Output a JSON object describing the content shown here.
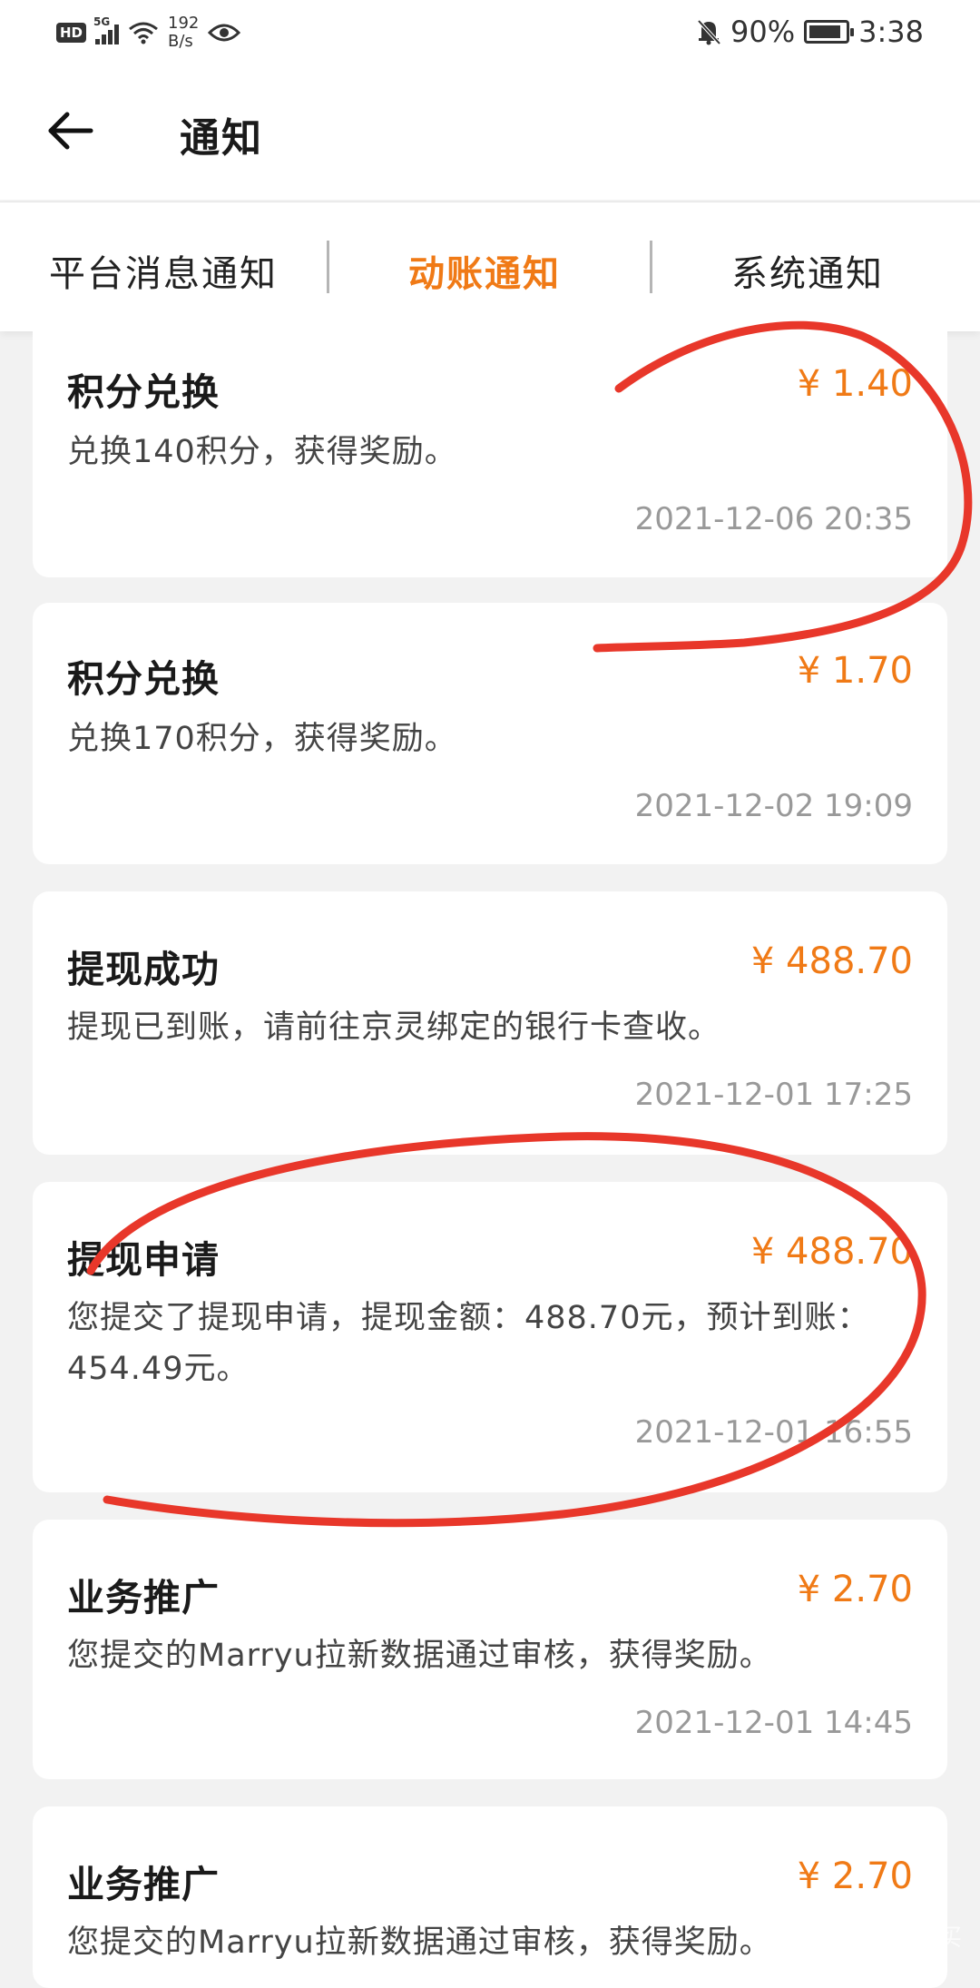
{
  "status_bar": {
    "hd": "HD",
    "network": "5G",
    "speed_value": "192",
    "speed_unit": "B/s",
    "battery": "90%",
    "battery_level": 0.9,
    "time": "3:38"
  },
  "header": {
    "title": "通知"
  },
  "tabs": [
    {
      "label": "平台消息通知",
      "active": false
    },
    {
      "label": "动账通知",
      "active": true
    },
    {
      "label": "系统通知",
      "active": false
    }
  ],
  "colors": {
    "accent": "#f07a16",
    "annotation": "#e8372a"
  },
  "cards": [
    {
      "title": "积分兑换",
      "amount": "¥ 1.40",
      "desc": "兑换140积分，获得奖励。",
      "time": "2021-12-06 20:35"
    },
    {
      "title": "积分兑换",
      "amount": "¥ 1.70",
      "desc": "兑换170积分，获得奖励。",
      "time": "2021-12-02 19:09"
    },
    {
      "title": "提现成功",
      "amount": "¥ 488.70",
      "desc": "提现已到账，请前往京灵绑定的银行卡查收。",
      "time": "2021-12-01 17:25"
    },
    {
      "title": "提现申请",
      "amount": "¥ 488.70",
      "desc": "您提交了提现申请，提现金额：488.70元，预计到账：454.49元。",
      "time": "2021-12-01 16:55"
    },
    {
      "title": "业务推广",
      "amount": "¥ 2.70",
      "desc": "您提交的Marryu拉新数据通过审核，获得奖励。",
      "time": "2021-12-01 14:45"
    },
    {
      "title": "业务推广",
      "amount": "¥ 2.70",
      "desc": "您提交的Marryu拉新数据通过审核，获得奖励。",
      "time": ""
    }
  ],
  "watermark": "值 什么值得买"
}
